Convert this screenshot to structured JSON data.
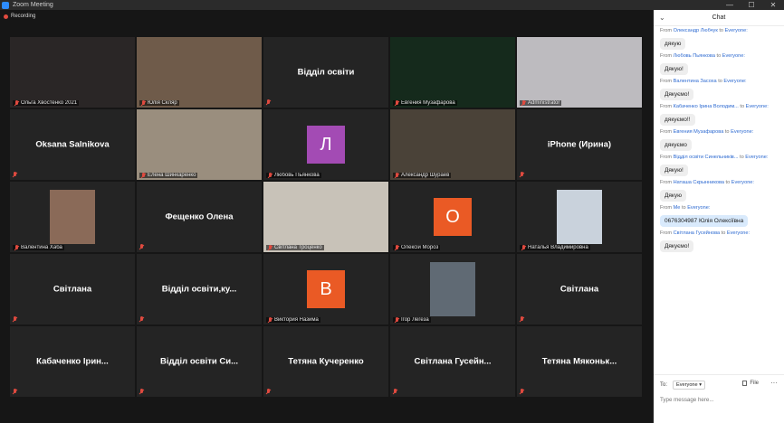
{
  "window": {
    "title": "Zoom Meeting",
    "minimize": "—",
    "maximize": "☐",
    "close": "✕"
  },
  "meeting": {
    "recording_label": "Recording"
  },
  "tiles": [
    {
      "name": "Ольга Хвостенко 2021",
      "type": "video",
      "bg": "#2a2626"
    },
    {
      "name": "Юлія Скляр",
      "type": "video",
      "bg": "#6f5b4a"
    },
    {
      "name": "Відділ освіти",
      "type": "name"
    },
    {
      "name": "Евгения Музафарова",
      "type": "video",
      "bg": "#152a1c"
    },
    {
      "name": "Administrator",
      "type": "video",
      "bg": "#bdbbbf"
    },
    {
      "name": "Oksana Salnikova",
      "type": "name"
    },
    {
      "name": "Елена Шинкаренко",
      "type": "video",
      "bg": "#9a8e7e"
    },
    {
      "name": "Любовь Пьянкова",
      "type": "avatar",
      "letter": "Л",
      "color": "#a34bb4"
    },
    {
      "name": "Александр Шураев",
      "type": "video",
      "bg": "#4a4238",
      "active": true
    },
    {
      "name": "iPhone (Ирина)",
      "type": "name"
    },
    {
      "name": "Валентина Хаба",
      "type": "video-small",
      "bg": "#8a6a58"
    },
    {
      "name": "Фещенко Олена",
      "type": "name"
    },
    {
      "name": "Світлана Троценко",
      "type": "video",
      "bg": "#c8c2b8"
    },
    {
      "name": "Олексій Мороз",
      "type": "avatar",
      "letter": "О",
      "color": "#ea5a25"
    },
    {
      "name": "Наталья Владимировна",
      "type": "video-small",
      "bg": "#c9d2dc"
    },
    {
      "name": "Світлана",
      "type": "name"
    },
    {
      "name": "Відділ освіти,ку...",
      "type": "name"
    },
    {
      "name": "Виктория Назима",
      "type": "avatar",
      "letter": "В",
      "color": "#ea5a25"
    },
    {
      "name": "Ігор Легеза",
      "type": "video-small",
      "bg": "#606a74"
    },
    {
      "name": "Світлана",
      "type": "name"
    },
    {
      "name": "Кабаченко Ірин...",
      "type": "name"
    },
    {
      "name": "Відділ освіти Си...",
      "type": "name"
    },
    {
      "name": "Тетяна Кучеренко",
      "type": "name"
    },
    {
      "name": "Світлана Гусейн...",
      "type": "name"
    },
    {
      "name": "Тетяна Мяконьк...",
      "type": "name"
    }
  ],
  "chat": {
    "title": "Chat",
    "collapse_icon": "⌄",
    "messages": [
      {
        "from_prefix": "From",
        "sender": "Олександр Любчук",
        "to_word": "to",
        "recipient": "Everyone:",
        "text": "дякую"
      },
      {
        "from_prefix": "From",
        "sender": "Любовь Пьянкова",
        "to_word": "to",
        "recipient": "Everyone:",
        "text": "Дякую!"
      },
      {
        "from_prefix": "From",
        "sender": "Валентина Засоха",
        "to_word": "to",
        "recipient": "Everyone:",
        "text": "Дякуємо!"
      },
      {
        "from_prefix": "From",
        "sender": "Кабаченко Ірина Володим...",
        "to_word": "to",
        "recipient": "Everyone:",
        "text": "дякуємо!!"
      },
      {
        "from_prefix": "From",
        "sender": "Евгения Музафарова",
        "to_word": "to",
        "recipient": "Everyone:",
        "text": "дякуємо"
      },
      {
        "from_prefix": "From",
        "sender": "Відділ освіти Синельників...",
        "to_word": "to",
        "recipient": "Everyone:",
        "text": "Дякую!"
      },
      {
        "from_prefix": "From",
        "sender": "Наташа Скрынникова",
        "to_word": "to",
        "recipient": "Everyone:",
        "text": "Дякую"
      },
      {
        "from_prefix": "From",
        "sender": "Me",
        "to_word": "to",
        "recipient": "Everyone:",
        "text": "0676304987 Юлія Олексіївна",
        "me": true
      },
      {
        "from_prefix": "From",
        "sender": "Світлана Гусейнова",
        "to_word": "to",
        "recipient": "Everyone:",
        "text": "Дякуємо!"
      }
    ],
    "to_label": "To:",
    "to_value": "Everyone ▾",
    "file_label": "File",
    "more_label": "···",
    "input_placeholder": "Type message here..."
  }
}
